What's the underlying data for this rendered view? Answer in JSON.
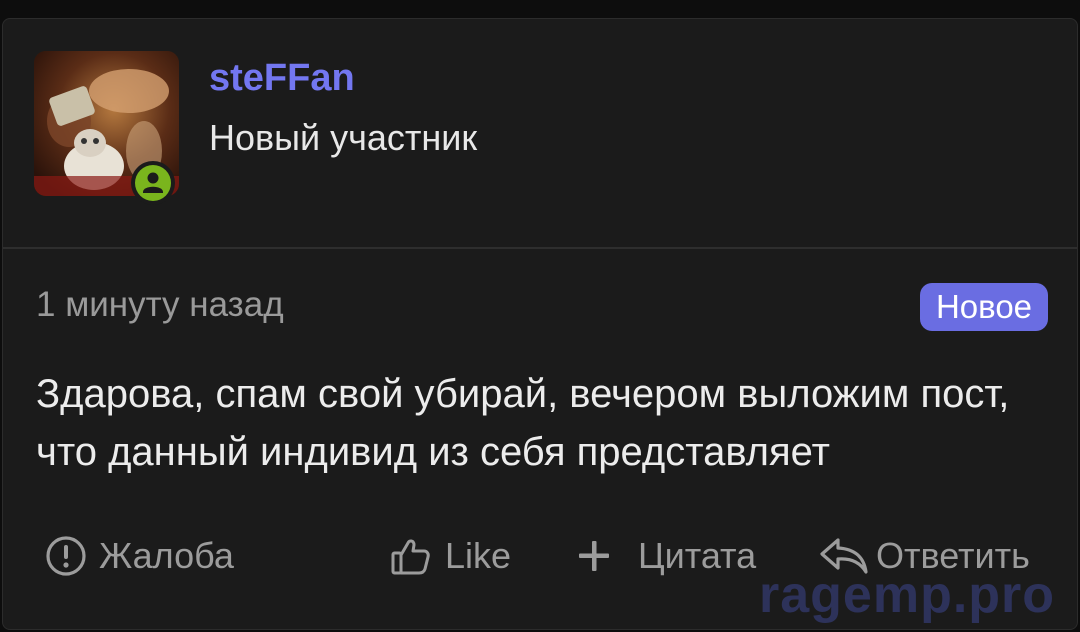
{
  "author": {
    "username": "steFFan",
    "title": "Новый участник",
    "status_color": "#7ab51d"
  },
  "post": {
    "time": "1 минуту назад",
    "badge": "Новое",
    "text": "Здарова, спам свой убирай, вечером выложим пост, что данный индивид из себя представляет"
  },
  "actions": {
    "report": "Жалоба",
    "like": "Like",
    "quote": "Цитата",
    "reply": "Ответить"
  },
  "watermark": "ragemp.pro",
  "colors": {
    "accent": "#7377f0",
    "badge_bg": "#6a6de2",
    "card_bg": "#1b1b1b"
  }
}
